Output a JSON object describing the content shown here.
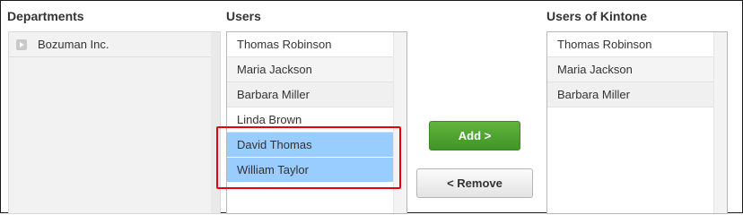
{
  "departments": {
    "title": "Departments",
    "items": [
      {
        "label": "Bozuman Inc."
      }
    ]
  },
  "users": {
    "title": "Users",
    "items": [
      {
        "label": "Thomas Robinson"
      },
      {
        "label": "Maria Jackson"
      },
      {
        "label": "Barbara Miller"
      },
      {
        "label": "Linda Brown"
      },
      {
        "label": "David Thomas",
        "selected": true
      },
      {
        "label": "William Taylor",
        "selected": true
      }
    ]
  },
  "actions": {
    "add_label": "Add >",
    "remove_label": "< Remove"
  },
  "kintone_users": {
    "title": "Users of Kintone",
    "items": [
      {
        "label": "Thomas Robinson"
      },
      {
        "label": "Maria Jackson"
      },
      {
        "label": "Barbara Miller"
      }
    ]
  },
  "colors": {
    "selection": "#99ccff",
    "add_button": "#4da52d",
    "highlight_border": "#e60012"
  }
}
